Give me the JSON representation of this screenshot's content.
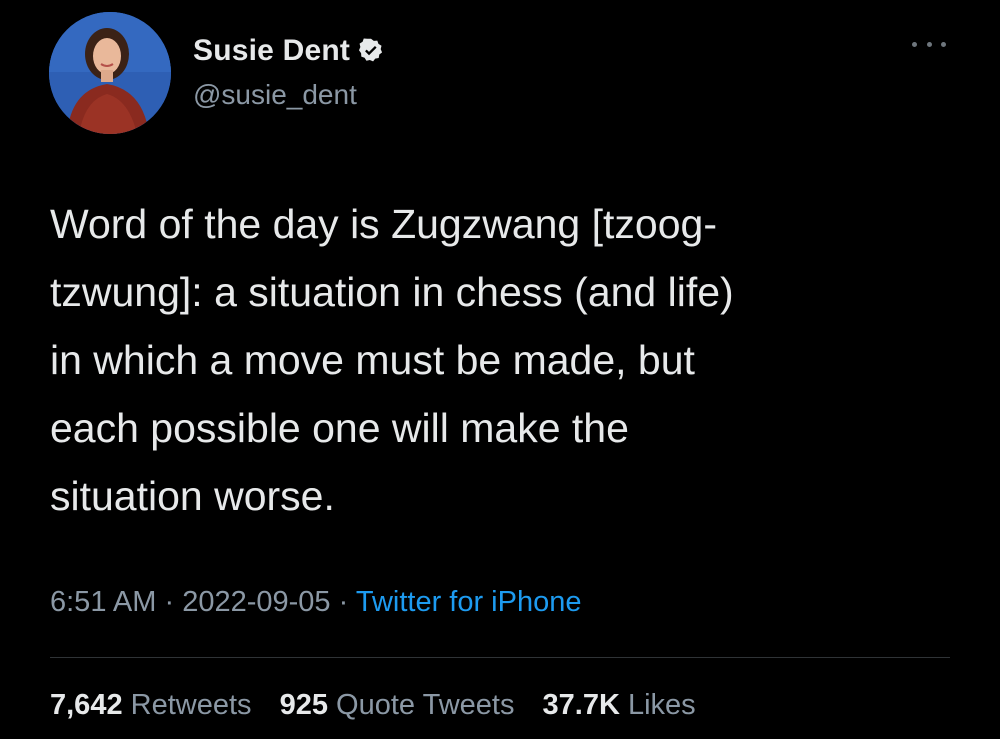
{
  "author": {
    "display_name": "Susie Dent",
    "handle": "@susie_dent",
    "verified": true,
    "verified_icon": "verified-badge-icon",
    "avatar_bg_color": "#2f62b8"
  },
  "menu": {
    "icon": "more-options-icon"
  },
  "tweet": {
    "text": "Word of the day is Zugzwang [tzoog-\ntzwung]: a situation in chess (and life)\nin which a move must be made, but\neach possible one will make the\nsituation worse.",
    "time": "6:51 AM",
    "date": "2022-09-05",
    "separator": "·",
    "source": "Twitter for iPhone"
  },
  "stats": {
    "retweets_count": "7,642",
    "retweets_label": "Retweets",
    "quote_tweets_count": "925",
    "quote_tweets_label": "Quote Tweets",
    "likes_count": "37.7K",
    "likes_label": "Likes"
  },
  "colors": {
    "background": "#000000",
    "primary_text": "#e7e9ea",
    "secondary_text": "#8b98a5",
    "link": "#1d9bf0",
    "divider": "#2f3336"
  }
}
